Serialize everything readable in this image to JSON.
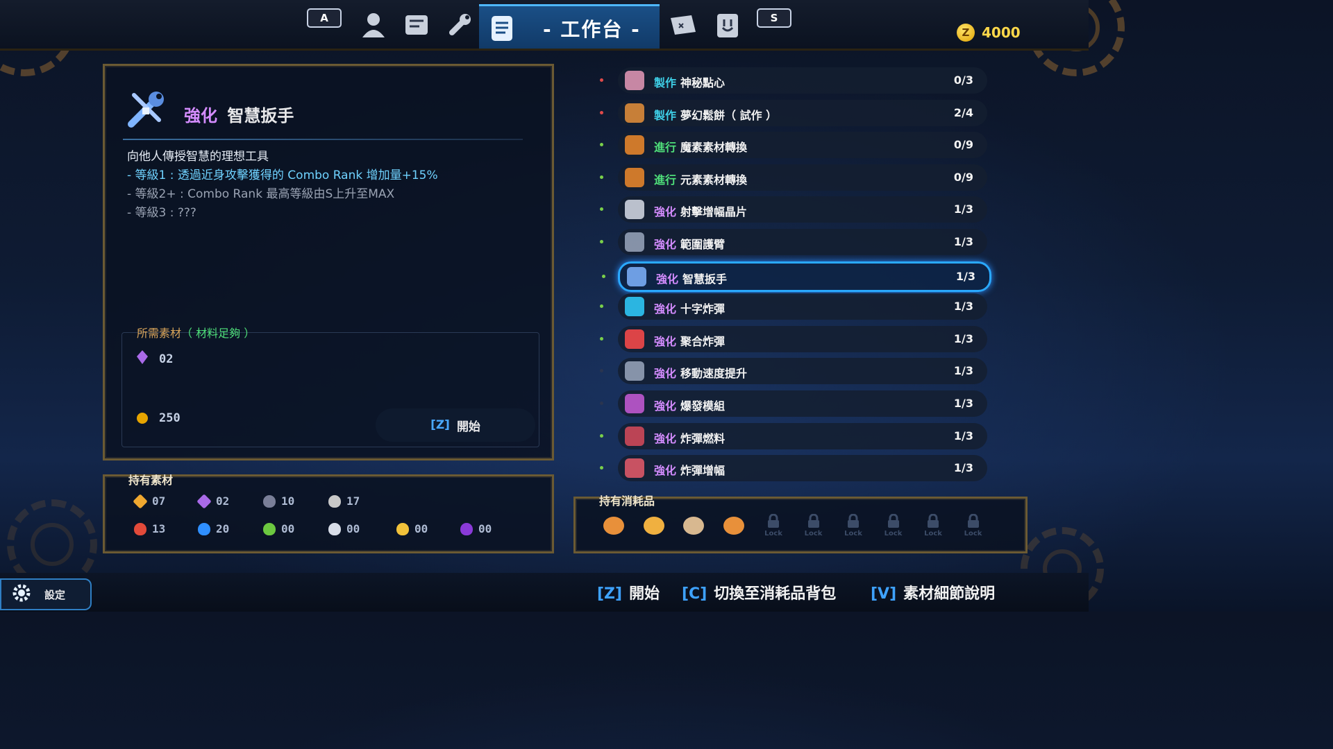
{
  "nav": {
    "left_key": "A",
    "right_key": "S",
    "active_title": "- 工作台 -",
    "icons": [
      "person-icon",
      "scroll-map-icon",
      "wrench-icon",
      "workbench-scroll-icon",
      "map-icon",
      "bunny-book-icon"
    ]
  },
  "currency": {
    "amount": "4000",
    "coin_symbol": "Z"
  },
  "detail": {
    "verb": "強化",
    "name": "智慧扳手",
    "desc_line1": "向他人傳授智慧的理想工具",
    "desc_line2": "- 等級1 : 透過近身攻擊獲得的 Combo Rank 增加量+15%",
    "desc_line3": "- 等級2+ : Combo Rank 最高等級由S上升至MAX",
    "desc_line4": "- 等級3 : ???",
    "req_label": "所需素材",
    "req_status": "（ 材料足夠 ）",
    "req_crystal": "02",
    "req_coins": "250",
    "start_key": "[Z]",
    "start_label": "開始"
  },
  "owned": {
    "title": "持有素材",
    "materials": [
      {
        "icon": "amber-crystal-icon",
        "count": "07",
        "color": "#f0a830"
      },
      {
        "icon": "purple-crystal-icon",
        "count": "02",
        "color": "#a96ae8"
      },
      {
        "icon": "dark-pouch-icon",
        "count": "10",
        "color": "#7a7f98"
      },
      {
        "icon": "light-pouch-icon",
        "count": "17",
        "color": "#c8c8c8"
      },
      {
        "icon": "red-slime-icon",
        "count": "13",
        "color": "#e24a3a"
      },
      {
        "icon": "blue-slime-icon",
        "count": "20",
        "color": "#2f8fff"
      },
      {
        "icon": "green-slime-icon",
        "count": "00",
        "color": "#6cc840"
      },
      {
        "icon": "white-slime-icon",
        "count": "00",
        "color": "#d8dde8"
      },
      {
        "icon": "yellow-slime-icon",
        "count": "00",
        "color": "#f2c23a"
      },
      {
        "icon": "violet-slime-icon",
        "count": "00",
        "color": "#8a3ad8"
      }
    ]
  },
  "recipes": [
    {
      "verb": "製作",
      "verb_color": "#3ed0e8",
      "name": "神秘點心",
      "count": "0/3",
      "dot": "#e04a4a",
      "icon_color": "#e89ab8"
    },
    {
      "verb": "製作",
      "verb_color": "#3ed0e8",
      "name": "夢幻鬆餅（ 試作 ）",
      "count": "2/4",
      "dot": "#e04a4a",
      "icon_color": "#e8903a"
    },
    {
      "verb": "進行",
      "verb_color": "#4fe07a",
      "name": "魔素素材轉換",
      "count": "0/9",
      "dot": "#7ad04a",
      "icon_color": "#f08a2a"
    },
    {
      "verb": "進行",
      "verb_color": "#4fe07a",
      "name": "元素素材轉換",
      "count": "0/9",
      "dot": "#7ad04a",
      "icon_color": "#f08a2a"
    },
    {
      "verb": "強化",
      "verb_color": "#d48cff",
      "name": "射擊增幅晶片",
      "count": "1/3",
      "dot": "#7ad04a",
      "icon_color": "#d8dde8"
    },
    {
      "verb": "強化",
      "verb_color": "#d48cff",
      "name": "範圍護臂",
      "count": "1/3",
      "dot": "#7ad04a",
      "icon_color": "#9aa7bd"
    },
    {
      "verb": "強化",
      "verb_color": "#d48cff",
      "name": "智慧扳手",
      "count": "1/3",
      "dot": "#7ad04a",
      "icon_color": "#7fb4ff"
    },
    {
      "verb": "強化",
      "verb_color": "#d48cff",
      "name": "十字炸彈",
      "count": "1/3",
      "dot": "#7ad04a",
      "icon_color": "#2fd0ff"
    },
    {
      "verb": "強化",
      "verb_color": "#d48cff",
      "name": "聚合炸彈",
      "count": "1/3",
      "dot": "#7ad04a",
      "icon_color": "#ff4a4a"
    },
    {
      "verb": "強化",
      "verb_color": "#d48cff",
      "name": "移動速度提升",
      "count": "1/3",
      "dot": "#2a3550",
      "icon_color": "#9aa7bd"
    },
    {
      "verb": "強化",
      "verb_color": "#d48cff",
      "name": "爆發模組",
      "count": "1/3",
      "dot": "#2a3550",
      "icon_color": "#c85ad8"
    },
    {
      "verb": "強化",
      "verb_color": "#d48cff",
      "name": "炸彈燃料",
      "count": "1/3",
      "dot": "#7ad04a",
      "icon_color": "#d84a5a"
    },
    {
      "verb": "強化",
      "verb_color": "#d48cff",
      "name": "炸彈增幅",
      "count": "1/3",
      "dot": "#7ad04a",
      "icon_color": "#e85a6a"
    }
  ],
  "consumables": {
    "title": "持有消耗品",
    "items": [
      "pancake-icon",
      "lollipop-icon",
      "snack-bag-icon",
      "pancake-icon"
    ],
    "lock_label": "Lock",
    "locked_slots": 6
  },
  "footer": {
    "settings_label": "設定",
    "hint1_key": "[Z]",
    "hint1_label": "開始",
    "hint2_key": "[C]",
    "hint2_label": "切換至消耗品背包",
    "hint3_key": "[V]",
    "hint3_label": "素材細節說明"
  }
}
